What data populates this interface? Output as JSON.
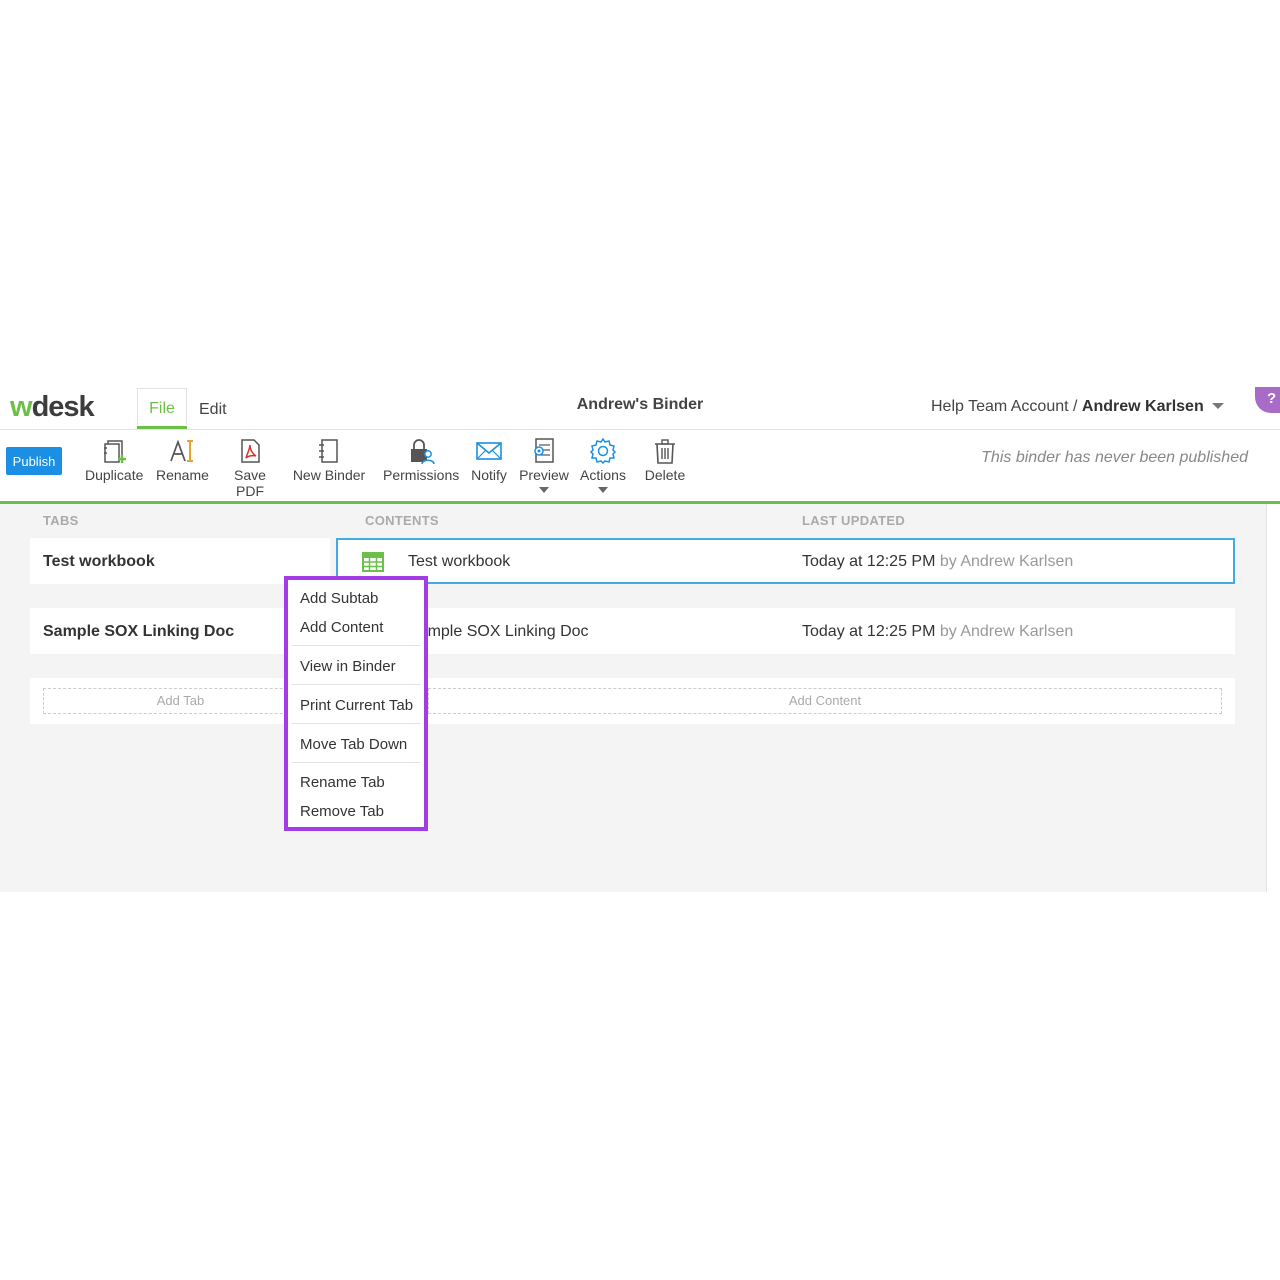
{
  "header": {
    "logo_w": "w",
    "logo_rest": "desk",
    "tabs": [
      {
        "label": "File"
      },
      {
        "label": "Edit"
      }
    ],
    "binder_title": "Andrew's Binder",
    "account_prefix": "Help Team Account / ",
    "account_user": "Andrew Karlsen",
    "help_label": "?"
  },
  "toolbar": {
    "publish_label": "Publish",
    "items": [
      {
        "label": "Duplicate",
        "icon": "duplicate-icon"
      },
      {
        "label": "Rename",
        "icon": "rename-icon"
      },
      {
        "label": "Save PDF",
        "icon": "pdf-icon"
      },
      {
        "label": "New Binder",
        "icon": "binder-icon"
      },
      {
        "label": "Permissions",
        "icon": "lock-user-icon"
      },
      {
        "label": "Notify",
        "icon": "mail-icon"
      },
      {
        "label": "Preview",
        "icon": "preview-icon"
      },
      {
        "label": "Actions",
        "icon": "gear-icon"
      },
      {
        "label": "Delete",
        "icon": "trash-icon"
      }
    ],
    "publish_note": "This binder has never been published"
  },
  "columns": {
    "tabs": "TABS",
    "contents": "CONTENTS",
    "last_updated": "LAST UPDATED"
  },
  "rows": [
    {
      "tab": "Test workbook",
      "content": "Test workbook",
      "updated": "Today at 12:25 PM",
      "by": "by Andrew Karlsen"
    },
    {
      "tab": "Sample SOX Linking Doc",
      "content": "Sample SOX Linking Doc",
      "updated": "Today at 12:25 PM",
      "by": "by Andrew Karlsen"
    }
  ],
  "add": {
    "tab_label": "Add Tab",
    "content_label": "Add Content"
  },
  "context_menu": {
    "items": [
      "Add Subtab",
      "Add Content",
      "View in Binder",
      "Print Current Tab",
      "Move Tab Down",
      "Rename Tab",
      "Remove Tab"
    ]
  },
  "colors": {
    "brand_green": "#6cc04a",
    "publish_blue": "#1a8fe3",
    "selection_blue": "#43a9e4",
    "menu_highlight": "#a23ce6",
    "help_purple": "#a86bc8"
  }
}
